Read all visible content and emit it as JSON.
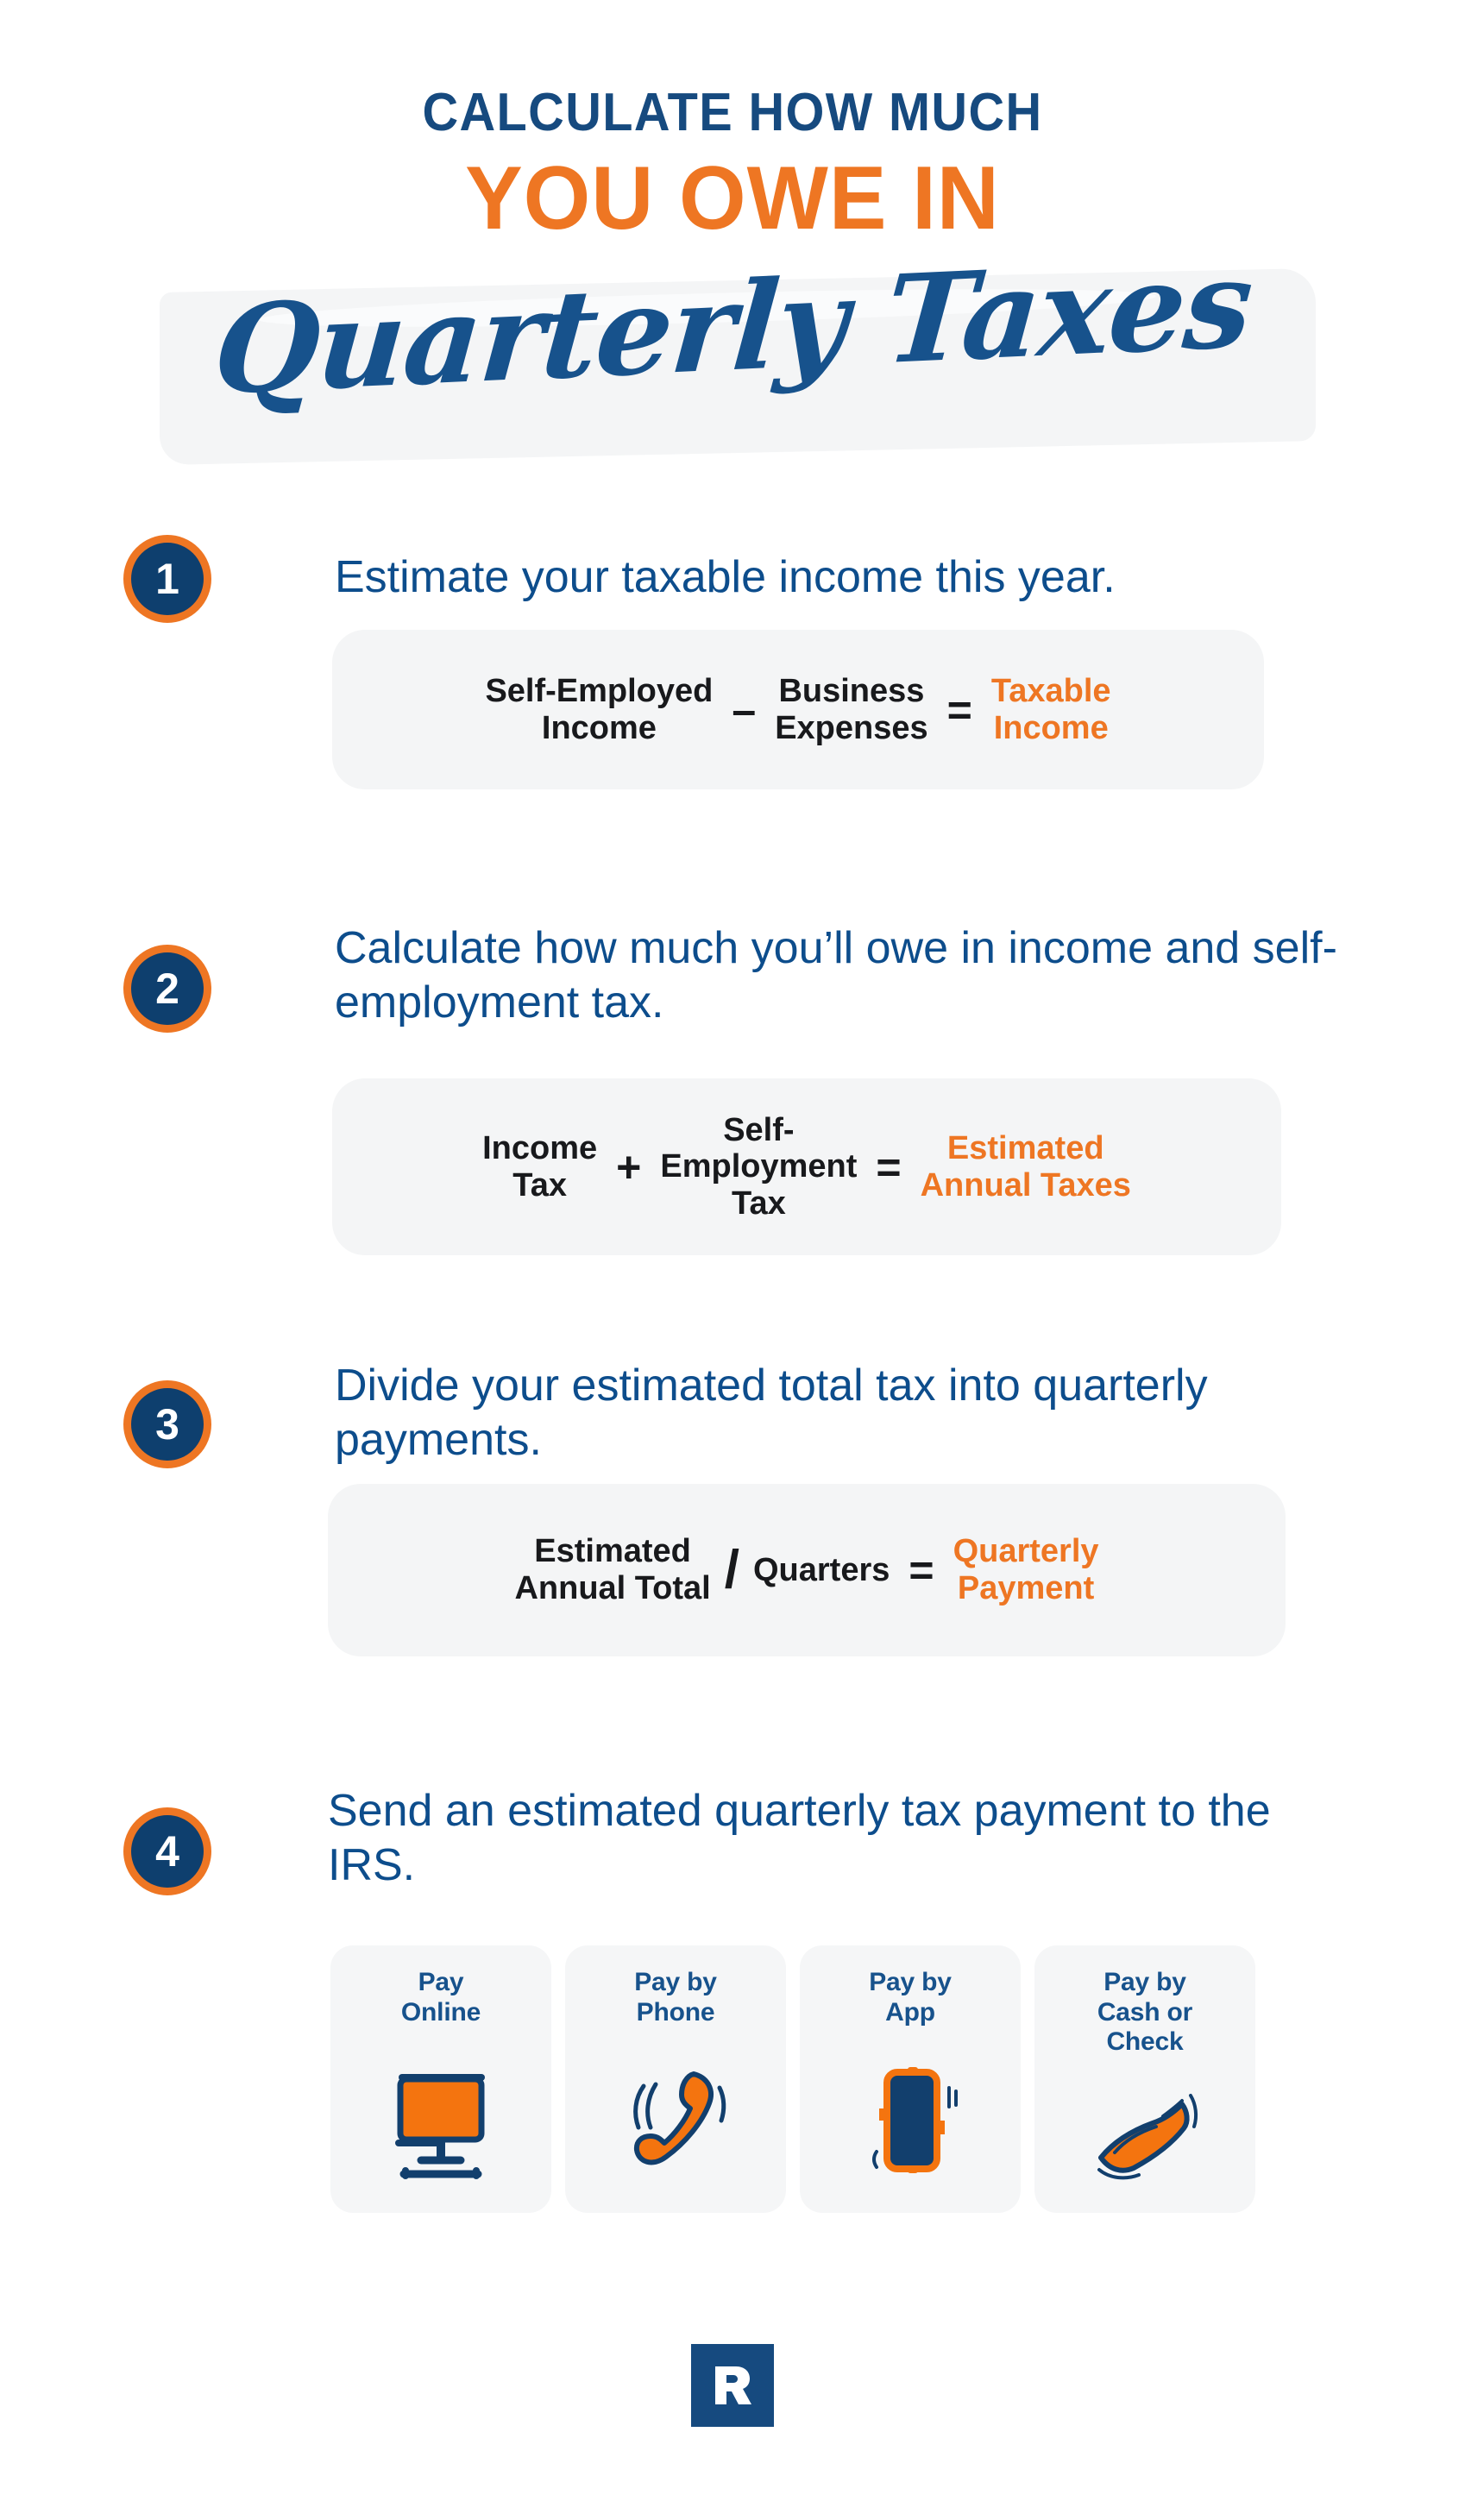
{
  "header": {
    "line1": "CALCULATE HOW MUCH",
    "line2": "YOU OWE IN",
    "script": "Quarterly Taxes"
  },
  "colors": {
    "navy": "#0e3f6e",
    "blue": "#0d4d8c",
    "title_blue": "#164a7f",
    "orange": "#ee7623",
    "box_bg": "#f4f5f6",
    "dark_text": "#18191c"
  },
  "steps": [
    {
      "number": "1",
      "heading": "Estimate your taxable income this year.",
      "formula": {
        "terms": [
          "Self-Employed\nIncome",
          "Business\nExpenses",
          "Taxable\nIncome"
        ],
        "operators": [
          "–",
          "="
        ],
        "result_index": 2
      }
    },
    {
      "number": "2",
      "heading": "Calculate how much you’ll owe in income and self-employment tax.",
      "formula": {
        "terms": [
          "Income\nTax",
          "Self-\nEmployment\nTax",
          "Estimated\nAnnual Taxes"
        ],
        "operators": [
          "+",
          "="
        ],
        "result_index": 2
      }
    },
    {
      "number": "3",
      "heading": "Divide your estimated total tax into quarterly payments.",
      "formula": {
        "terms": [
          "Estimated\nAnnual Total",
          "Quarters",
          "Quarterly\nPayment"
        ],
        "operators": [
          "/",
          "="
        ],
        "result_index": 2
      }
    },
    {
      "number": "4",
      "heading": "Send an estimated quarterly tax payment to the IRS.",
      "formula": null
    }
  ],
  "payment_cards": [
    {
      "label": "Pay\nOnline",
      "icon": "monitor-icon"
    },
    {
      "label": "Pay by\nPhone",
      "icon": "phone-handset-icon"
    },
    {
      "label": "Pay by\nApp",
      "icon": "mobile-phone-icon"
    },
    {
      "label": "Pay by\nCash or\nCheck",
      "icon": "cash-check-icon"
    }
  ],
  "footer": {
    "logo_letter": "R"
  }
}
